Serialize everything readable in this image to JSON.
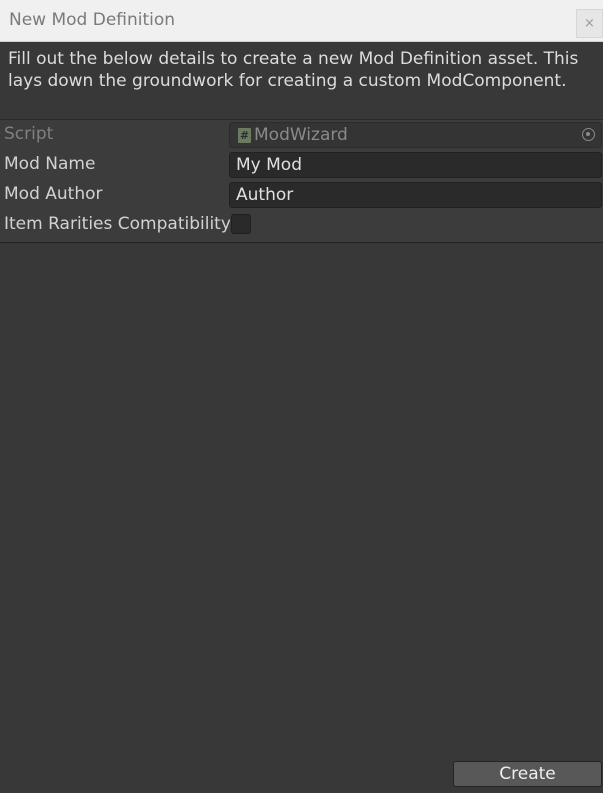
{
  "window": {
    "title": "New Mod Definition",
    "close_label": "×"
  },
  "description": "Fill out the below details to create a new Mod Definition asset. This lays down the groundwork for creating a custom ModComponent.",
  "fields": {
    "script": {
      "label": "Script",
      "value": "ModWizard",
      "icon_glyph": "#"
    },
    "mod_name": {
      "label": "Mod Name",
      "value": "My Mod"
    },
    "mod_author": {
      "label": "Mod Author",
      "value": "Author"
    },
    "item_rarities": {
      "label": "Item Rarities Compatibility",
      "checked": false
    }
  },
  "actions": {
    "create_label": "Create"
  },
  "colors": {
    "background": "#383838",
    "titlebar": "#f0f0f0",
    "field": "#2a2a2a",
    "button": "#585858",
    "text": "#d2d2d2"
  }
}
